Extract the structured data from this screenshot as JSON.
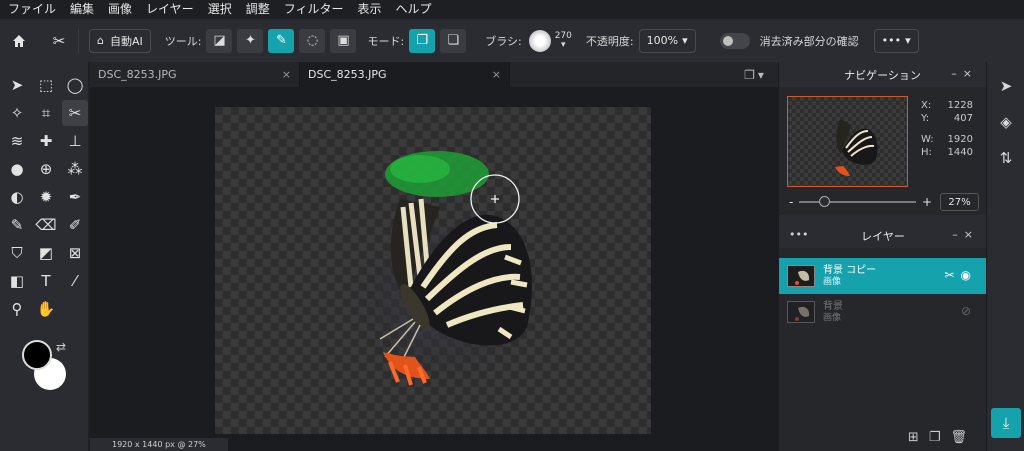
{
  "menu": [
    "ファイル",
    "編集",
    "画像",
    "レイヤー",
    "選択",
    "調整",
    "フィルター",
    "表示",
    "ヘルプ"
  ],
  "toolbar": {
    "auto_ai": "自動AI",
    "tool_label": "ツール:",
    "mode_label": "モード:",
    "brush_label": "ブラシ:",
    "brush_size": "270",
    "opacity_label": "不透明度:",
    "opacity_value": "100%",
    "confirm_label": "消去済み部分の確認",
    "more": "•••"
  },
  "tabs": [
    {
      "label": "DSC_8253.JPG",
      "close": "×"
    },
    {
      "label": "DSC_8253.JPG",
      "close": "×"
    }
  ],
  "status": "1920 x 1440 px @ 27%",
  "navigation": {
    "title": "ナビゲーション",
    "x_label": "X:",
    "x_value": "1228",
    "y_label": "Y:",
    "y_value": "407",
    "w_label": "W:",
    "w_value": "1920",
    "h_label": "H:",
    "h_value": "1440",
    "zoom_minus": "-",
    "zoom_plus": "+",
    "zoom_value": "27%"
  },
  "layers": {
    "title": "レイヤー",
    "items": [
      {
        "name": "背景 コピー",
        "type": "画像"
      },
      {
        "name": "背景",
        "type": "画像"
      }
    ]
  },
  "colors": {
    "accent": "#15a2ad",
    "foreground": "#000000",
    "background": "#ffffff"
  }
}
